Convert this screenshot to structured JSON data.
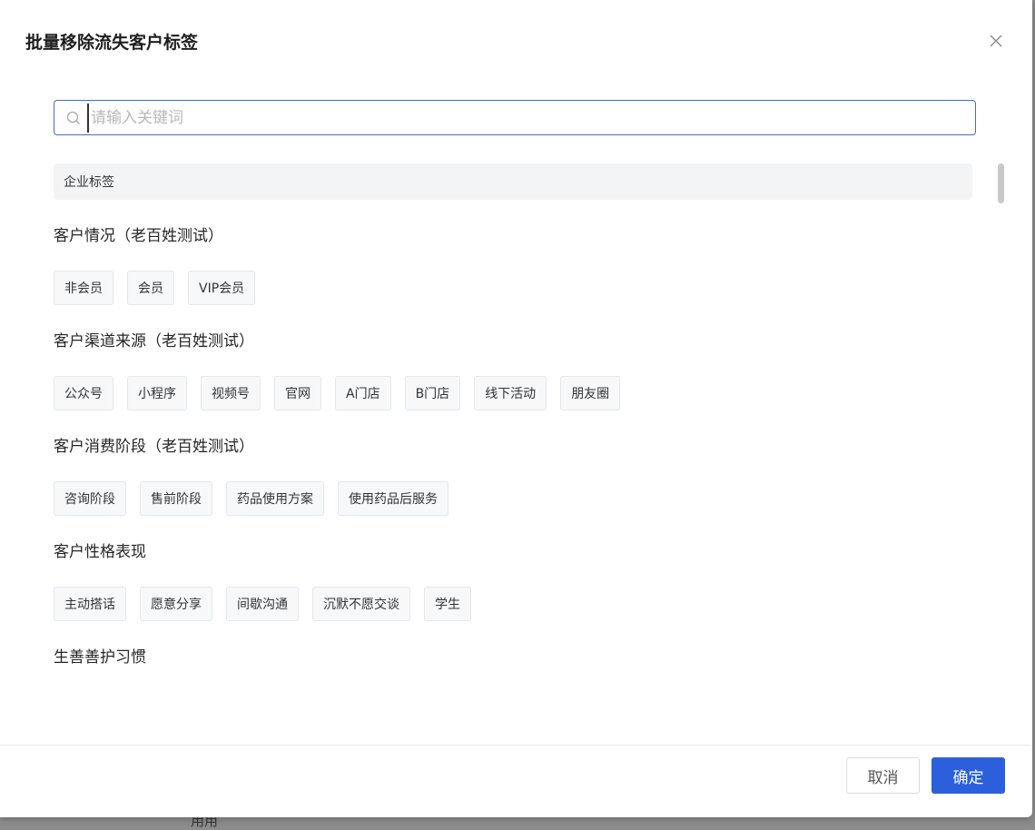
{
  "backdrop": {
    "text": "用用"
  },
  "modal": {
    "title": "批量移除流失客户标签",
    "close_icon": "close-icon"
  },
  "search": {
    "placeholder": "请输入关键词",
    "value": ""
  },
  "section": {
    "label": "企业标签"
  },
  "groups": [
    {
      "title": "客户情况（老百姓测试）",
      "tags": [
        "非会员",
        "会员",
        "VIP会员"
      ]
    },
    {
      "title": "客户渠道来源（老百姓测试）",
      "tags": [
        "公众号",
        "小程序",
        "视频号",
        "官网",
        "A门店",
        "B门店",
        "线下活动",
        "朋友圈"
      ]
    },
    {
      "title": "客户消费阶段（老百姓测试）",
      "tags": [
        "咨询阶段",
        "售前阶段",
        "药品使用方案",
        "使用药品后服务"
      ]
    },
    {
      "title": "客户性格表现",
      "tags": [
        "主动搭话",
        "愿意分享",
        "间歇沟通",
        "沉默不愿交谈",
        "学生"
      ]
    }
  ],
  "cut_off_title": "生善善护习惯",
  "footer": {
    "cancel_label": "取消",
    "ok_label": "确定"
  },
  "colors": {
    "primary": "#2b5fdb",
    "tag_bg": "#f7f8fa",
    "section_bg": "#f3f4f6"
  }
}
